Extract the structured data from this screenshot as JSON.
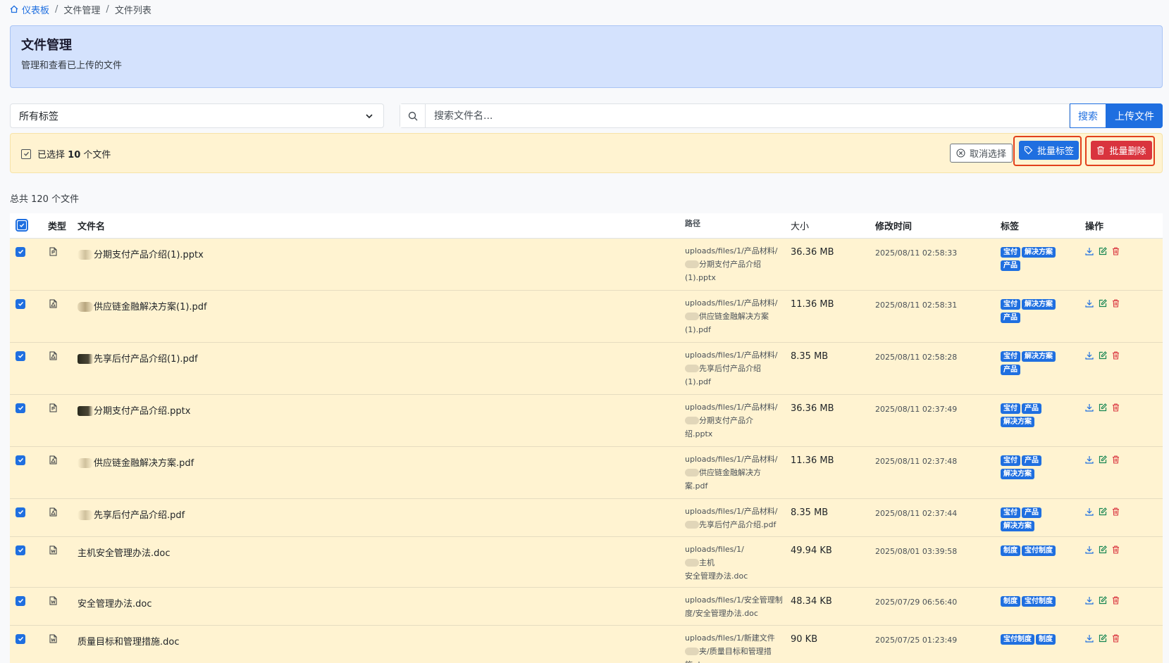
{
  "breadcrumb": {
    "home": "仪表板",
    "level2": "文件管理",
    "level3": "文件列表"
  },
  "header": {
    "title": "文件管理",
    "subtitle": "管理和查看已上传的文件"
  },
  "filter": {
    "tag_select_value": "所有标签",
    "search_placeholder": "搜索文件名...",
    "search_label": "搜索",
    "upload_label": "上传文件"
  },
  "selection": {
    "prefix": "已选择",
    "count": "10",
    "suffix": "个文件",
    "cancel_label": "取消选择",
    "batch_tag_label": "批量标签",
    "batch_delete_label": "批量删除"
  },
  "total_text": "总共 120 个文件",
  "table": {
    "headers": {
      "type": "类型",
      "name": "文件名",
      "path": "路径",
      "size": "大小",
      "time": "修改时间",
      "tags": "标签",
      "ops": "操作"
    },
    "rows": [
      {
        "icon": "ppt-file-icon",
        "name": "分期支付产品介绍(1).pptx",
        "path_a": "uploads/files/1/产品材料/",
        "path_b": "分期支付产品介绍",
        "path_c": "(1).pptx",
        "size": "36.36 MB",
        "time": "2025/08/11 02:58:33",
        "tags": [
          "宝付",
          "解决方案",
          "产品"
        ]
      },
      {
        "icon": "pdf-file-icon",
        "name": "供应链金融解决方案(1).pdf",
        "path_a": "uploads/files/1/产品材料/",
        "path_b": "供应链金融解决方案",
        "path_c": "(1).pdf",
        "size": "11.36 MB",
        "time": "2025/08/11 02:58:31",
        "tags": [
          "宝付",
          "解决方案",
          "产品"
        ]
      },
      {
        "icon": "pdf-file-icon",
        "name": "先享后付产品介绍(1).pdf",
        "path_a": "uploads/files/1/产品材料/",
        "path_b": "先享后付产品介绍",
        "path_c": "(1).pdf",
        "size": "8.35 MB",
        "time": "2025/08/11 02:58:28",
        "tags": [
          "宝付",
          "解决方案",
          "产品"
        ]
      },
      {
        "icon": "ppt-file-icon",
        "name": "分期支付产品介绍.pptx",
        "path_a": "uploads/files/1/产品材料/",
        "path_b": "分期支付产品介",
        "path_c": "绍.pptx",
        "size": "36.36 MB",
        "time": "2025/08/11 02:37:49",
        "tags": [
          "宝付",
          "产品",
          "解决方案"
        ]
      },
      {
        "icon": "pdf-file-icon",
        "name": "供应链金融解决方案.pdf",
        "path_a": "uploads/files/1/产品材料/",
        "path_b": "供应链金融解决方",
        "path_c": "案.pdf",
        "size": "11.36 MB",
        "time": "2025/08/11 02:37:48",
        "tags": [
          "宝付",
          "产品",
          "解决方案"
        ]
      },
      {
        "icon": "pdf-file-icon",
        "name": "先享后付产品介绍.pdf",
        "path_a": "uploads/files/1/产品材料/",
        "path_b": "先享后付产品介绍.pdf",
        "path_c": "",
        "size": "8.35 MB",
        "time": "2025/08/11 02:37:44",
        "tags": [
          "宝付",
          "产品",
          "解决方案"
        ]
      },
      {
        "icon": "word-file-icon",
        "name": "主机安全管理办法.doc",
        "path_a": "uploads/files/1/",
        "path_b": "主机",
        "path_c": "安全管理办法.doc",
        "size": "49.94 KB",
        "time": "2025/08/01 03:39:58",
        "tags": [
          "制度",
          "宝付制度"
        ]
      },
      {
        "icon": "word-file-icon",
        "name": "安全管理办法.doc",
        "path_a": "uploads/files/1/安全管理制",
        "path_b": "度/安全管理办法.doc",
        "path_c": "",
        "size": "48.34 KB",
        "time": "2025/07/29 06:56:40",
        "tags": [
          "制度",
          "宝付制度"
        ]
      },
      {
        "icon": "word-file-icon",
        "name": "质量目标和管理措施.doc",
        "path_a": "uploads/files/1/新建文件",
        "path_b": "夹/质量目标和管理措",
        "path_c": "施.doc",
        "size": "90 KB",
        "time": "2025/07/25 01:23:49",
        "tags": [
          "宝付制度",
          "制度"
        ]
      }
    ]
  },
  "colors": {
    "primary": "#1f6fe0",
    "danger": "#d9343e",
    "selected_row": "#fff3d1",
    "header_card": "#d4e2fd",
    "highlight": "#e2401c"
  }
}
